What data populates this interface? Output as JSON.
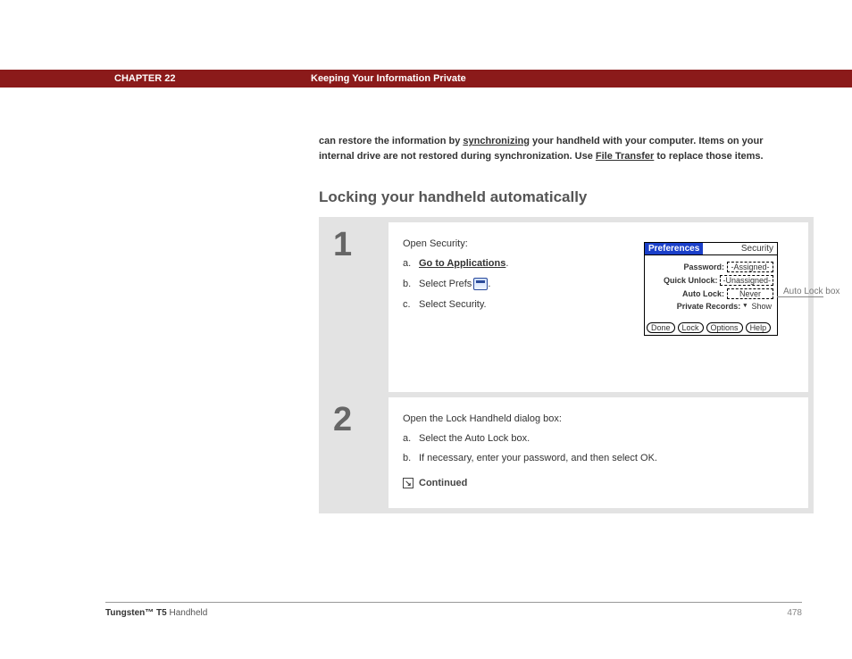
{
  "header": {
    "chapter_label": "CHAPTER 22",
    "chapter_title": "Keeping Your Information Private"
  },
  "intro": {
    "line1_prefix": "can restore the information by ",
    "link1": "synchronizing",
    "line1_mid": " your handheld with your computer. Items on your internal drive are not restored during synchronization. Use ",
    "link2": "File Transfer",
    "line1_suffix": " to replace those items."
  },
  "section_heading": "Locking your handheld automatically",
  "steps": [
    {
      "num": "1",
      "lead": "Open Security:",
      "items": [
        {
          "letter": "a.",
          "text": "Go to Applications",
          "suffix": ".",
          "link": true
        },
        {
          "letter": "b.",
          "text": "Select Prefs ",
          "suffix": ".",
          "icon": true
        },
        {
          "letter": "c.",
          "text": "Select Security.",
          "suffix": ""
        }
      ]
    },
    {
      "num": "2",
      "lead": "Open the Lock Handheld dialog box:",
      "items": [
        {
          "letter": "a.",
          "text": "Select the Auto Lock box."
        },
        {
          "letter": "b.",
          "text": "If necessary, enter your password, and then select OK."
        }
      ],
      "continued": "Continued"
    }
  ],
  "palm": {
    "title_left": "Preferences",
    "title_right": "Security",
    "rows": [
      {
        "label": "Password:",
        "value": "-Assigned-"
      },
      {
        "label": "Quick Unlock:",
        "value": "-Unassigned-"
      },
      {
        "label": "Auto Lock:",
        "value": "Never"
      },
      {
        "label": "Private Records:",
        "value_plain": "Show",
        "dropdown": true
      }
    ],
    "buttons": [
      "Done",
      "Lock",
      "Options",
      "Help"
    ]
  },
  "callout": "Auto Lock box",
  "footer": {
    "product_bold": "Tungsten™ T5",
    "product_rest": " Handheld",
    "page": "478"
  }
}
